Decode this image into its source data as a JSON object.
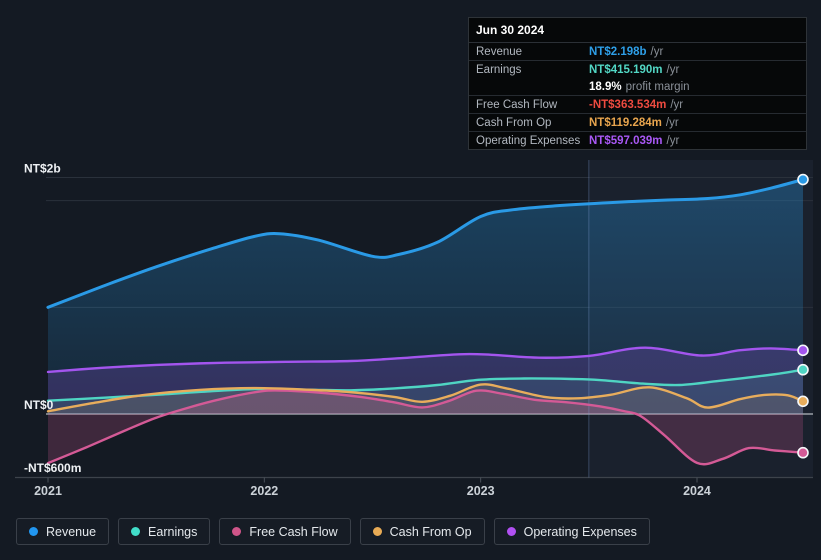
{
  "chart_data": {
    "type": "area",
    "y_unit": "NT$ millions",
    "x_ticks": [
      2021,
      2022,
      2023,
      2024
    ],
    "x_tick_labels": [
      "2021",
      "2022",
      "2023",
      "2024"
    ],
    "x_range": [
      2021.0,
      2024.49
    ],
    "y_range": [
      -600,
      2217
    ],
    "y_gridline_values": [
      2217,
      2000,
      1000,
      0,
      -600
    ],
    "y_axis_labels": [
      {
        "text": "NT$2b",
        "value": 2000
      },
      {
        "text": "NT$0",
        "value": 0
      },
      {
        "text": "-NT$600m",
        "value": -600
      }
    ],
    "highlight_from_x": 2023.5,
    "grid": true,
    "legend_position": "bottom",
    "series": [
      {
        "name": "Revenue",
        "color": "#2a9ae6",
        "points": [
          [
            2021.0,
            1000
          ],
          [
            2021.25,
            1195
          ],
          [
            2021.5,
            1380
          ],
          [
            2021.75,
            1545
          ],
          [
            2021.95,
            1663
          ],
          [
            2022.07,
            1690
          ],
          [
            2022.25,
            1630
          ],
          [
            2022.5,
            1478
          ],
          [
            2022.62,
            1495
          ],
          [
            2022.8,
            1610
          ],
          [
            2023.0,
            1852
          ],
          [
            2023.15,
            1915
          ],
          [
            2023.35,
            1952
          ],
          [
            2023.6,
            1982
          ],
          [
            2023.85,
            2005
          ],
          [
            2024.05,
            2020
          ],
          [
            2024.2,
            2055
          ],
          [
            2024.35,
            2122
          ],
          [
            2024.49,
            2198
          ]
        ]
      },
      {
        "name": "Earnings",
        "color": "#4fd5c3",
        "points": [
          [
            2021.0,
            125
          ],
          [
            2021.25,
            152
          ],
          [
            2021.5,
            180
          ],
          [
            2021.75,
            213
          ],
          [
            2021.97,
            234
          ],
          [
            2022.2,
            228
          ],
          [
            2022.4,
            222
          ],
          [
            2022.6,
            240
          ],
          [
            2022.8,
            272
          ],
          [
            2023.0,
            322
          ],
          [
            2023.2,
            333
          ],
          [
            2023.42,
            328
          ],
          [
            2023.55,
            318
          ],
          [
            2023.75,
            285
          ],
          [
            2023.92,
            272
          ],
          [
            2024.1,
            310
          ],
          [
            2024.25,
            345
          ],
          [
            2024.4,
            385
          ],
          [
            2024.49,
            415
          ]
        ]
      },
      {
        "name": "Free Cash Flow",
        "color": "#d45a96",
        "points": [
          [
            2021.0,
            -460
          ],
          [
            2021.18,
            -310
          ],
          [
            2021.35,
            -160
          ],
          [
            2021.5,
            -35
          ],
          [
            2021.65,
            60
          ],
          [
            2021.8,
            140
          ],
          [
            2021.97,
            208
          ],
          [
            2022.07,
            220
          ],
          [
            2022.25,
            202
          ],
          [
            2022.45,
            158
          ],
          [
            2022.6,
            110
          ],
          [
            2022.73,
            62
          ],
          [
            2022.85,
            120
          ],
          [
            2022.98,
            218
          ],
          [
            2023.1,
            190
          ],
          [
            2023.25,
            133
          ],
          [
            2023.4,
            110
          ],
          [
            2023.55,
            72
          ],
          [
            2023.66,
            28
          ],
          [
            2023.74,
            -20
          ],
          [
            2023.85,
            -200
          ],
          [
            2024.0,
            -458
          ],
          [
            2024.12,
            -420
          ],
          [
            2024.24,
            -320
          ],
          [
            2024.36,
            -342
          ],
          [
            2024.49,
            -363
          ]
        ]
      },
      {
        "name": "Cash From Op",
        "color": "#e8ad5c",
        "points": [
          [
            2021.0,
            25
          ],
          [
            2021.2,
            100
          ],
          [
            2021.45,
            180
          ],
          [
            2021.7,
            226
          ],
          [
            2021.95,
            243
          ],
          [
            2022.2,
            228
          ],
          [
            2022.4,
            204
          ],
          [
            2022.6,
            160
          ],
          [
            2022.73,
            114
          ],
          [
            2022.86,
            172
          ],
          [
            2023.0,
            276
          ],
          [
            2023.12,
            240
          ],
          [
            2023.3,
            158
          ],
          [
            2023.45,
            147
          ],
          [
            2023.6,
            180
          ],
          [
            2023.78,
            250
          ],
          [
            2023.95,
            150
          ],
          [
            2024.05,
            60
          ],
          [
            2024.2,
            140
          ],
          [
            2024.32,
            180
          ],
          [
            2024.42,
            175
          ],
          [
            2024.49,
            119
          ]
        ]
      },
      {
        "name": "Operating Expenses",
        "color": "#a355ee",
        "points": [
          [
            2021.0,
            395
          ],
          [
            2021.25,
            433
          ],
          [
            2021.5,
            460
          ],
          [
            2021.8,
            480
          ],
          [
            2022.1,
            489
          ],
          [
            2022.4,
            497
          ],
          [
            2022.63,
            523
          ],
          [
            2022.9,
            560
          ],
          [
            2023.05,
            555
          ],
          [
            2023.27,
            528
          ],
          [
            2023.5,
            545
          ],
          [
            2023.76,
            622
          ],
          [
            2024.02,
            548
          ],
          [
            2024.2,
            598
          ],
          [
            2024.34,
            615
          ],
          [
            2024.49,
            597
          ]
        ]
      }
    ]
  },
  "tooltip": {
    "date": "Jun 30 2024",
    "rows": [
      {
        "label": "Revenue",
        "value": "NT$2.198b",
        "suffix": "/yr",
        "color": "#2e9fe8"
      },
      {
        "label": "Earnings",
        "value": "NT$415.190m",
        "suffix": "/yr",
        "color": "#52d7c5"
      },
      {
        "label": "Free Cash Flow",
        "value": "-NT$363.534m",
        "suffix": "/yr",
        "color": "#ee4b40"
      },
      {
        "label": "Cash From Op",
        "value": "NT$119.284m",
        "suffix": "/yr",
        "color": "#e8a54e"
      },
      {
        "label": "Operating Expenses",
        "value": "NT$597.039m",
        "suffix": "/yr",
        "color": "#a958f5"
      }
    ],
    "profit_margin": {
      "value": "18.9%",
      "label": "profit margin"
    }
  },
  "legend": {
    "items": [
      {
        "label": "Revenue",
        "color": "#2196f0"
      },
      {
        "label": "Earnings",
        "color": "#41ddc9"
      },
      {
        "label": "Free Cash Flow",
        "color": "#cf5589"
      },
      {
        "label": "Cash From Op",
        "color": "#e8ab55"
      },
      {
        "label": "Operating Expenses",
        "color": "#b150f2"
      }
    ]
  }
}
